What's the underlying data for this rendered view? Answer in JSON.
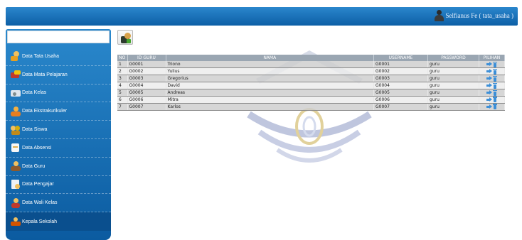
{
  "header": {
    "user_label": "Selfianus Fe ( tata_usaha )",
    "bar_color": "#1670b9"
  },
  "sidebar": {
    "search_value": "",
    "items": [
      {
        "label": "Data Tata Usaha",
        "icon": "user-key-icon"
      },
      {
        "label": "Data Mata Pelajaran",
        "icon": "books-icon"
      },
      {
        "label": "Data Kelas",
        "icon": "classroom-icon"
      },
      {
        "label": "Data Ekstrakurikuler",
        "icon": "people-icon"
      },
      {
        "label": "Data Siswa",
        "icon": "students-icon"
      },
      {
        "label": "Data Absensi",
        "icon": "notepad-icon"
      },
      {
        "label": "Data Guru",
        "icon": "teacher-icon"
      },
      {
        "label": "Data Pengajar",
        "icon": "document-icon"
      },
      {
        "label": "Data Wali Kelas",
        "icon": "homeroom-icon"
      },
      {
        "label": "Kepala Sekolah",
        "icon": "principal-icon"
      }
    ]
  },
  "toolbar": {
    "add_icon": "add-user-icon"
  },
  "table": {
    "headers": [
      "NO",
      "ID GURU",
      "NAMA",
      "USERNAME",
      "PASSWORD",
      "PILIHAN"
    ],
    "rows": [
      [
        "1",
        "G0001",
        "Triono",
        "G0001",
        "guru"
      ],
      [
        "2",
        "G0002",
        "Yulius",
        "G0002",
        "guru"
      ],
      [
        "3",
        "G0003",
        "Gregorius",
        "G0003",
        "guru"
      ],
      [
        "4",
        "G0004",
        "David",
        "G0004",
        "guru"
      ],
      [
        "5",
        "G0005",
        "Andreas",
        "G0005",
        "guru"
      ],
      [
        "6",
        "G0006",
        "Mitra",
        "G0006",
        "guru"
      ],
      [
        "7",
        "G0007",
        "Karlos",
        "G0007",
        "guru"
      ]
    ]
  }
}
